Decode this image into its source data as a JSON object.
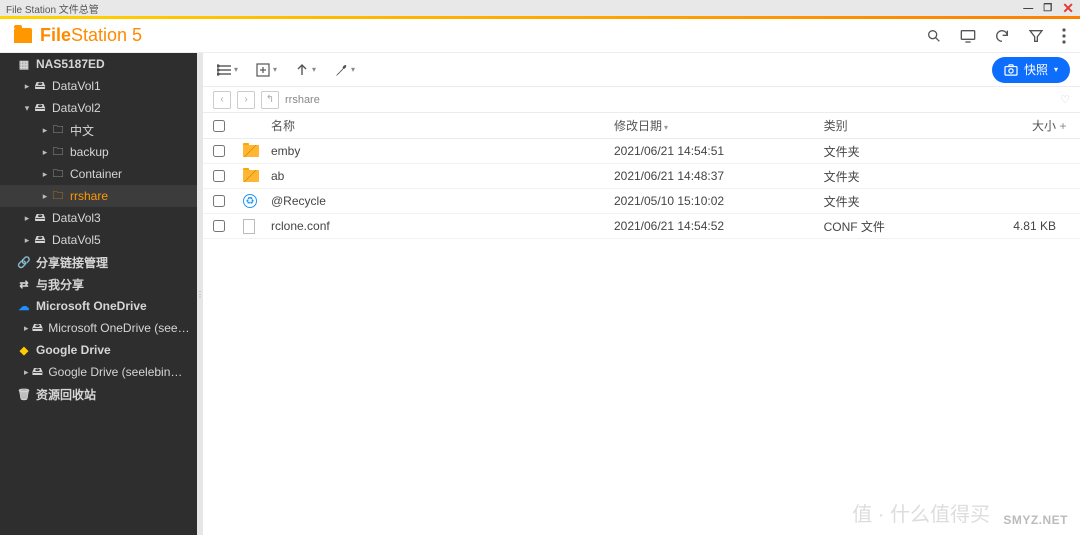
{
  "window": {
    "title": "File Station 文件总管"
  },
  "brand": {
    "name_bold": "File",
    "name_light": "Station 5"
  },
  "snapshot_btn": "快照",
  "breadcrumb": "rrshare",
  "sidebar": {
    "root": "NAS5187ED",
    "v1": "DataVol1",
    "v2": "DataVol2",
    "v2_cn": "中文",
    "v2_backup": "backup",
    "v2_container": "Container",
    "v2_rrshare": "rrshare",
    "v3": "DataVol3",
    "v5": "DataVol5",
    "share": "分享链接管理",
    "withme": "与我分享",
    "onedrive": "Microsoft OneDrive",
    "onedrive_acc": "Microsoft OneDrive (seelebin@",
    "gdrive": "Google Drive",
    "gdrive_acc": "Google Drive (seelebin@gmail.",
    "recycle": "资源回收站"
  },
  "columns": {
    "name": "名称",
    "date": "修改日期",
    "type": "类别",
    "size": "大小"
  },
  "rows": [
    {
      "name": "emby",
      "date": "2021/06/21 14:54:51",
      "type": "文件夹",
      "size": "",
      "icon": "folder-open"
    },
    {
      "name": "ab",
      "date": "2021/06/21 14:48:37",
      "type": "文件夹",
      "size": "",
      "icon": "folder-open"
    },
    {
      "name": "@Recycle",
      "date": "2021/05/10 15:10:02",
      "type": "文件夹",
      "size": "",
      "icon": "recycle"
    },
    {
      "name": "rclone.conf",
      "date": "2021/06/21 14:54:52",
      "type": "CONF 文件",
      "size": "4.81 KB",
      "icon": "file"
    }
  ],
  "watermark": "SMYZ.NET",
  "watermark2": "值 · 什么值得买"
}
